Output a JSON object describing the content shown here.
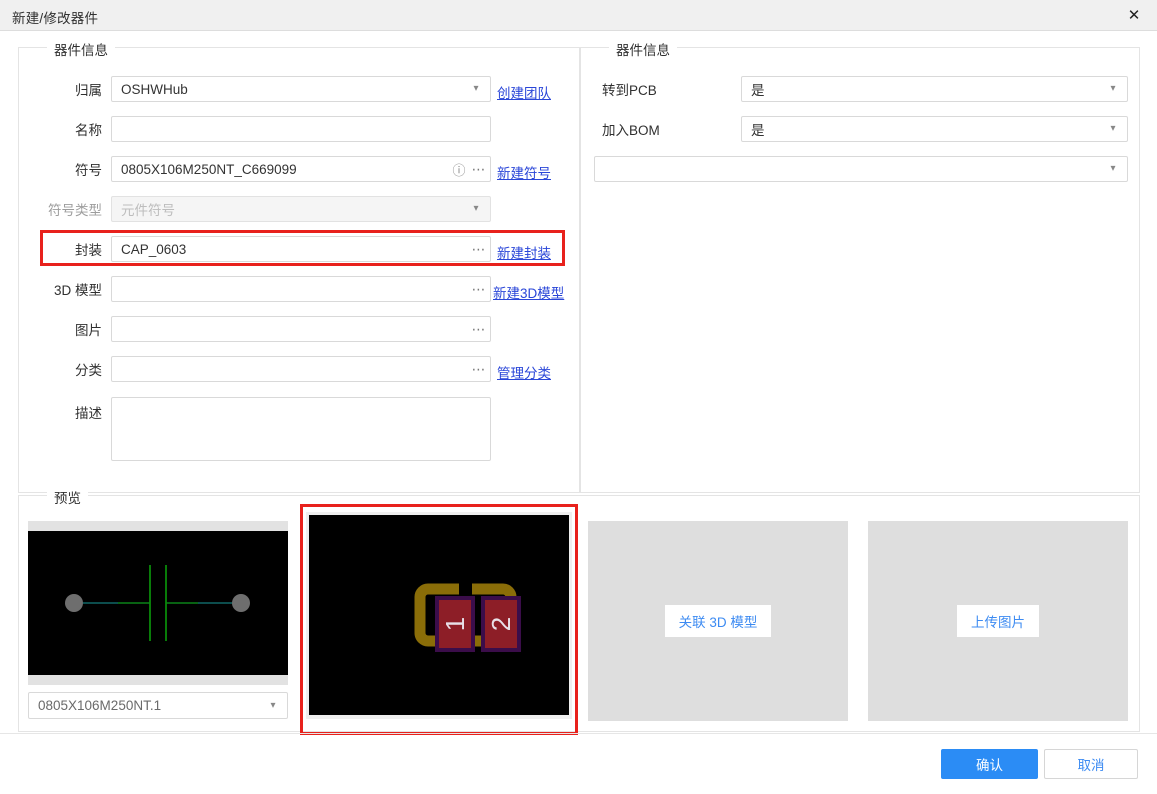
{
  "window": {
    "title": "新建/修改器件",
    "close_icon": "close-icon",
    "close_glyph": "✕"
  },
  "left_panel": {
    "legend": "器件信息",
    "fields": [
      {
        "label": "归属",
        "value": "OSHWHub",
        "type": "select",
        "link": "创建团队"
      },
      {
        "label": "名称",
        "value": "",
        "type": "text",
        "link": ""
      },
      {
        "label": "符号",
        "value": "0805X106M250NT_C669099",
        "type": "picker-clear",
        "link": "新建符号"
      },
      {
        "label": "符号类型",
        "value": "元件符号",
        "type": "select-disabled",
        "link": ""
      },
      {
        "label": "封装",
        "value": "CAP_0603",
        "type": "picker",
        "link": "新建封装"
      },
      {
        "label": "3D 模型",
        "value": "",
        "type": "picker",
        "link": "新建3D模型"
      },
      {
        "label": "图片",
        "value": "",
        "type": "picker",
        "link": ""
      },
      {
        "label": "分类",
        "value": "",
        "type": "picker",
        "link": "管理分类"
      },
      {
        "label": "描述",
        "value": "",
        "type": "textarea",
        "link": ""
      }
    ]
  },
  "right_panel": {
    "legend": "器件信息",
    "fields": [
      {
        "label": "转到PCB",
        "value": "是"
      },
      {
        "label": "加入BOM",
        "value": "是"
      },
      {
        "label": "",
        "value": ""
      }
    ]
  },
  "preview_panel": {
    "legend": "预览",
    "symbol_select_value": "0805X106M250NT.1",
    "footprint_pads": [
      "1",
      "2"
    ],
    "model_tile_button": "关联 3D 模型",
    "image_tile_button": "上传图片"
  },
  "footer": {
    "confirm": "确认",
    "cancel": "取消"
  },
  "colors": {
    "accent": "#2b8cf5",
    "link": "#2a46d8",
    "highlight": "#e8211c",
    "tile_bg": "#dedede",
    "pad_copper": "#8d1e27",
    "pad_outline": "#3b0d4a",
    "silk": "#8a6d08",
    "symbol_line": "#0a8a0a",
    "symbol_pin": "#137b7b"
  }
}
